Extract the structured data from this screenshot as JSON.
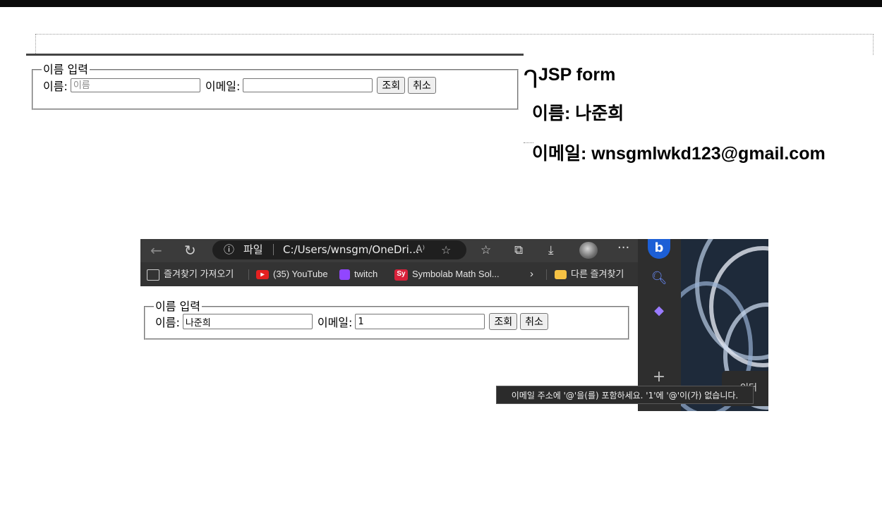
{
  "form": {
    "legend": "이름 입력",
    "name_label": "이름:",
    "name_placeholder": "이름",
    "name_value": "",
    "email_label": "이메일:",
    "email_value": "",
    "search_button": "조회",
    "cancel_button": "취소"
  },
  "result": {
    "bracket": "ᒉ",
    "heading": "JSP form",
    "name_line": "이름: 나준희",
    "email_line": "이메일: wnsgmlwkd123@gmail.com"
  },
  "browser": {
    "url": {
      "file_label": "파일",
      "path": "C:/Users/wnsgm/OneDri...",
      "reading_icon": "A⁾"
    },
    "bookmarks": [
      {
        "label": "즐겨찾기 가져오기"
      },
      {
        "label": "(35) YouTube"
      },
      {
        "label": "twitch"
      },
      {
        "label": "Symbolab Math Sol..."
      }
    ],
    "other_favorites": "다른 즐겨찾기",
    "sy_badge": "Sy",
    "form": {
      "legend": "이름 입력",
      "name_label": "이름:",
      "name_value": "나준희",
      "email_label": "이메일:",
      "email_value": "1",
      "search_button": "조회",
      "cancel_button": "취소"
    },
    "tooltip": "이메일 주소에 '@'을(를) 포함하세요. '1'에 '@'이(가) 없습니다.",
    "taskbar_popup": "인터"
  }
}
